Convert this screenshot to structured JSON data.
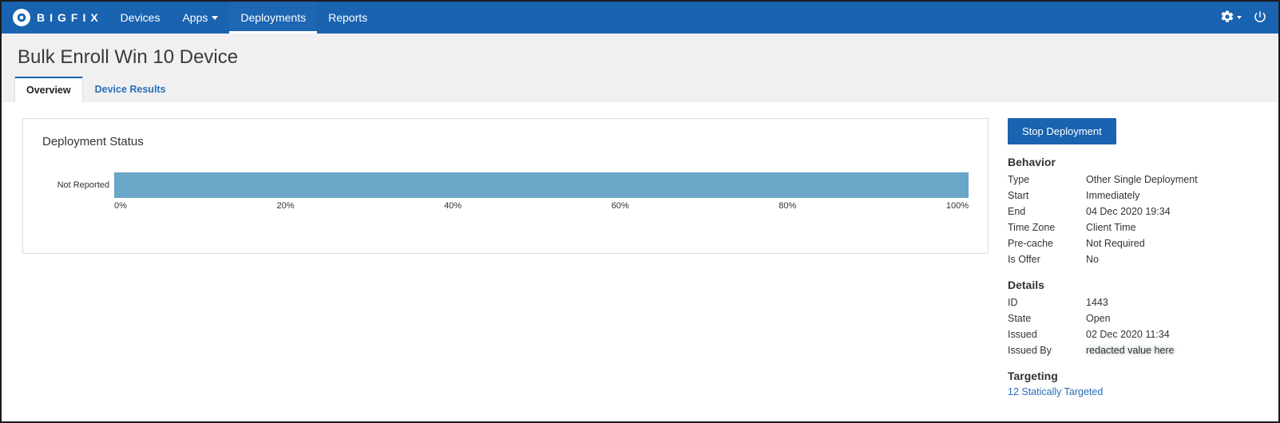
{
  "brand": {
    "name": "BIGFIX"
  },
  "nav": {
    "devices": "Devices",
    "apps": "Apps",
    "deployments": "Deployments",
    "reports": "Reports"
  },
  "page": {
    "title": "Bulk Enroll Win 10 Device"
  },
  "tabs": {
    "overview": "Overview",
    "device_results": "Device Results"
  },
  "card": {
    "title": "Deployment Status"
  },
  "chart_data": {
    "type": "bar",
    "orientation": "horizontal",
    "categories": [
      "Not Reported"
    ],
    "values": [
      100
    ],
    "xlabel": "",
    "ylabel": "",
    "xlim": [
      0,
      100
    ],
    "ticks": [
      "0%",
      "20%",
      "40%",
      "60%",
      "80%",
      "100%"
    ],
    "bar_color": "#6aa6c8"
  },
  "actions": {
    "stop": "Stop Deployment"
  },
  "behavior": {
    "heading": "Behavior",
    "type_label": "Type",
    "type_value": "Other Single Deployment",
    "start_label": "Start",
    "start_value": "Immediately",
    "end_label": "End",
    "end_value": "04 Dec 2020 19:34",
    "tz_label": "Time Zone",
    "tz_value": "Client Time",
    "precache_label": "Pre-cache",
    "precache_value": "Not Required",
    "offer_label": "Is Offer",
    "offer_value": "No"
  },
  "details": {
    "heading": "Details",
    "id_label": "ID",
    "id_value": "1443",
    "state_label": "State",
    "state_value": "Open",
    "issued_label": "Issued",
    "issued_value": "02 Dec 2020 11:34",
    "issued_by_label": "Issued By",
    "issued_by_value": "redacted value here"
  },
  "targeting": {
    "heading": "Targeting",
    "link": "12 Statically Targeted"
  }
}
